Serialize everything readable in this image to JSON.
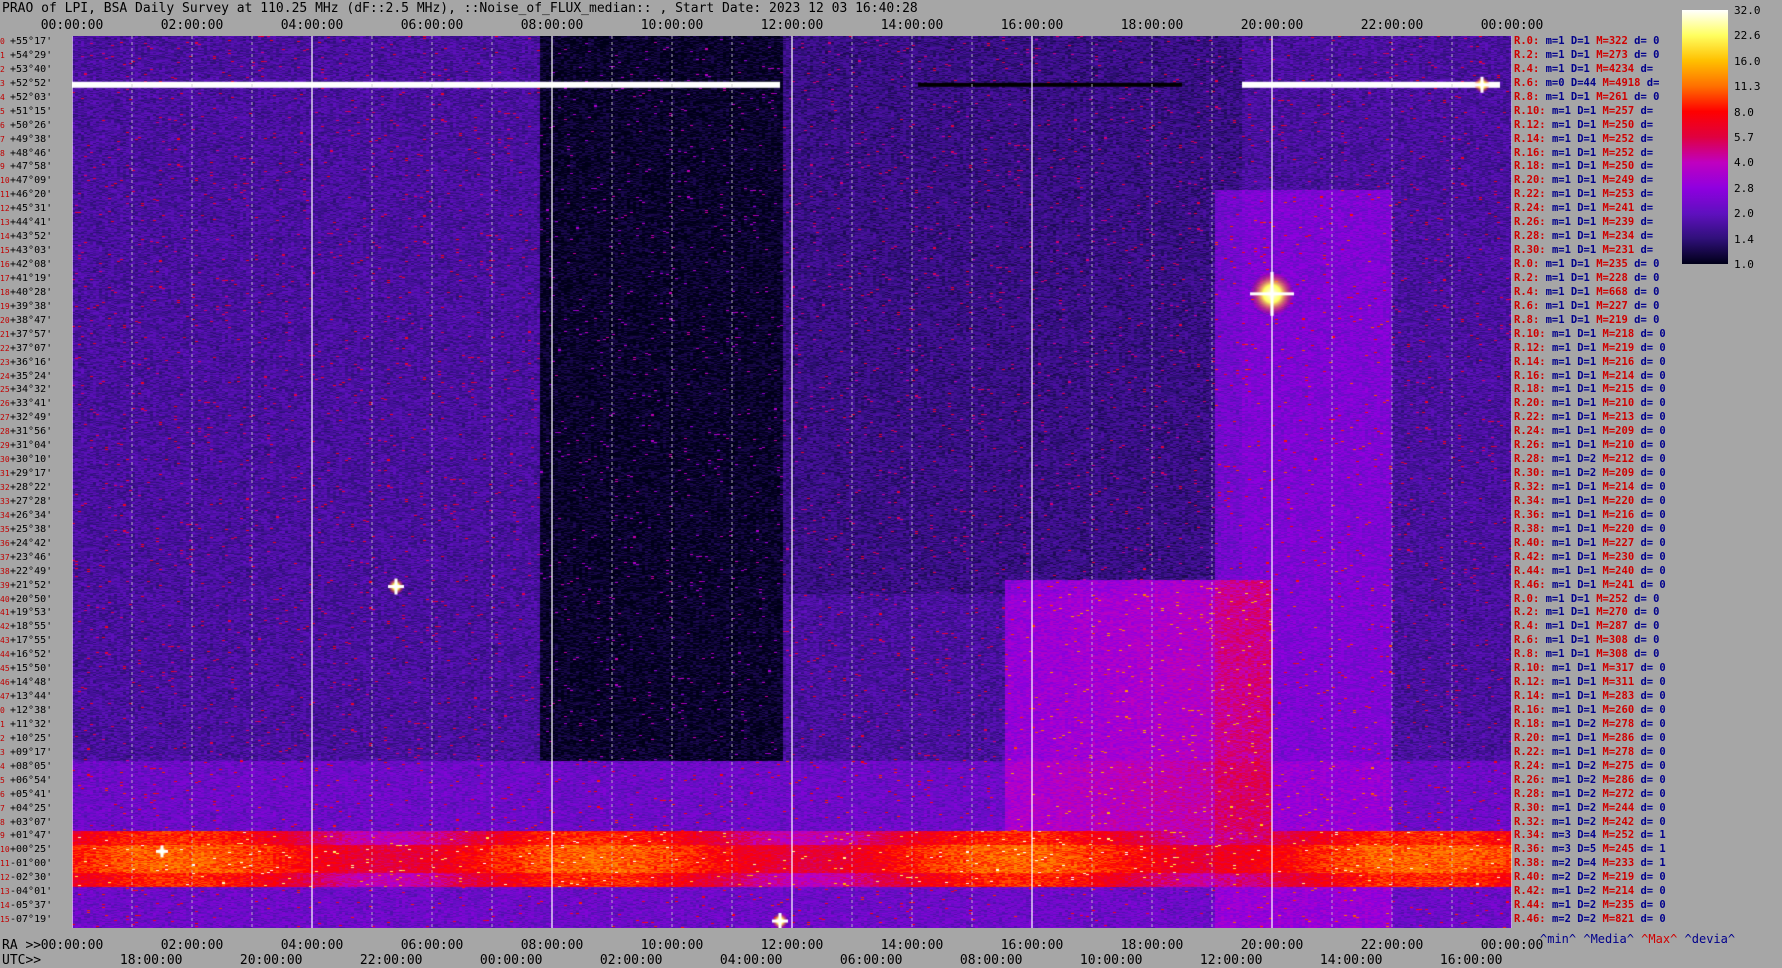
{
  "title": "PRAO of LPI, BSA Daily Survey at 110.25 MHz (dF::2.5 MHz), ::Noise_of_FLUX_median:: , Start Date: 2023 12 03 16:40:28",
  "axes": {
    "ra_prefix": "RA >>",
    "utc_prefix": "UTC>>"
  },
  "top_ticks": [
    "00:00:00",
    "02:00:00",
    "04:00:00",
    "06:00:00",
    "08:00:00",
    "10:00:00",
    "12:00:00",
    "14:00:00",
    "16:00:00",
    "18:00:00",
    "20:00:00",
    "22:00:00",
    "00:00:00"
  ],
  "bottom_ra_ticks": [
    "00:00:00",
    "02:00:00",
    "04:00:00",
    "06:00:00",
    "08:00:00",
    "10:00:00",
    "12:00:00",
    "14:00:00",
    "16:00:00",
    "18:00:00",
    "20:00:00",
    "22:00:00",
    "00:00:00"
  ],
  "bottom_utc_ticks": [
    "18:00:00",
    "20:00:00",
    "22:00:00",
    "00:00:00",
    "02:00:00",
    "04:00:00",
    "06:00:00",
    "08:00:00",
    "10:00:00",
    "12:00:00",
    "14:00:00",
    "16:00:00"
  ],
  "declinations": [
    "+55°17'",
    "+54°29'",
    "+53°40'",
    "+52°52'",
    "+52°03'",
    "+51°15'",
    "+50°26'",
    "+49°38'",
    "+48°46'",
    "+47°58'",
    "+47°09'",
    "+46°20'",
    "+45°31'",
    "+44°41'",
    "+43°52'",
    "+43°03'",
    "+42°08'",
    "+41°19'",
    "+40°28'",
    "+39°38'",
    "+38°47'",
    "+37°57'",
    "+37°07'",
    "+36°16'",
    "+35°24'",
    "+34°32'",
    "+33°41'",
    "+32°49'",
    "+31°56'",
    "+31°04'",
    "+30°10'",
    "+29°17'",
    "+28°22'",
    "+27°28'",
    "+26°34'",
    "+25°38'",
    "+24°42'",
    "+23°46'",
    "+22°49'",
    "+21°52'",
    "+20°50'",
    "+19°53'",
    "+18°55'",
    "+17°55'",
    "+16°52'",
    "+15°50'",
    "+14°48'",
    "+13°44'",
    "+12°38'",
    "+11°32'",
    "+10°25'",
    "+09°17'",
    "+08°05'",
    "+06°54'",
    "+05°41'",
    "+04°25'",
    "+03°07'",
    "+01°47'",
    "+00°25'",
    "-01°00'",
    "-02°30'",
    "-04°01'",
    "-05°37'",
    "-07°19'"
  ],
  "row_stats": [
    {
      "r": "R.0:",
      "m": "m=1",
      "D": "D=1",
      "M": "M=322",
      "d": "d= 0"
    },
    {
      "r": "R.2:",
      "m": "m=1",
      "D": "D=1",
      "M": "M=273",
      "d": "d= 0"
    },
    {
      "r": "R.4:",
      "m": "m=1",
      "D": "D=1",
      "M": "M=4234",
      "d": "d="
    },
    {
      "r": "R.6:",
      "m": "m=0",
      "D": "D=44",
      "M": "M=4918",
      "d": "d="
    },
    {
      "r": "R.8:",
      "m": "m=1",
      "D": "D=1",
      "M": "M=261",
      "d": "d= 0"
    },
    {
      "r": "R.10:",
      "m": "m=1",
      "D": "D=1",
      "M": "M=257",
      "d": "d="
    },
    {
      "r": "R.12:",
      "m": "m=1",
      "D": "D=1",
      "M": "M=250",
      "d": "d="
    },
    {
      "r": "R.14:",
      "m": "m=1",
      "D": "D=1",
      "M": "M=252",
      "d": "d="
    },
    {
      "r": "R.16:",
      "m": "m=1",
      "D": "D=1",
      "M": "M=252",
      "d": "d="
    },
    {
      "r": "R.18:",
      "m": "m=1",
      "D": "D=1",
      "M": "M=250",
      "d": "d="
    },
    {
      "r": "R.20:",
      "m": "m=1",
      "D": "D=1",
      "M": "M=249",
      "d": "d="
    },
    {
      "r": "R.22:",
      "m": "m=1",
      "D": "D=1",
      "M": "M=253",
      "d": "d="
    },
    {
      "r": "R.24:",
      "m": "m=1",
      "D": "D=1",
      "M": "M=241",
      "d": "d="
    },
    {
      "r": "R.26:",
      "m": "m=1",
      "D": "D=1",
      "M": "M=239",
      "d": "d="
    },
    {
      "r": "R.28:",
      "m": "m=1",
      "D": "D=1",
      "M": "M=234",
      "d": "d="
    },
    {
      "r": "R.30:",
      "m": "m=1",
      "D": "D=1",
      "M": "M=231",
      "d": "d="
    },
    {
      "r": "R.0:",
      "m": "m=1",
      "D": "D=1",
      "M": "M=235",
      "d": "d= 0"
    },
    {
      "r": "R.2:",
      "m": "m=1",
      "D": "D=1",
      "M": "M=228",
      "d": "d= 0"
    },
    {
      "r": "R.4:",
      "m": "m=1",
      "D": "D=1",
      "M": "M=668",
      "d": "d= 0"
    },
    {
      "r": "R.6:",
      "m": "m=1",
      "D": "D=1",
      "M": "M=227",
      "d": "d= 0"
    },
    {
      "r": "R.8:",
      "m": "m=1",
      "D": "D=1",
      "M": "M=219",
      "d": "d= 0"
    },
    {
      "r": "R.10:",
      "m": "m=1",
      "D": "D=1",
      "M": "M=218",
      "d": "d= 0"
    },
    {
      "r": "R.12:",
      "m": "m=1",
      "D": "D=1",
      "M": "M=219",
      "d": "d= 0"
    },
    {
      "r": "R.14:",
      "m": "m=1",
      "D": "D=1",
      "M": "M=216",
      "d": "d= 0"
    },
    {
      "r": "R.16:",
      "m": "m=1",
      "D": "D=1",
      "M": "M=214",
      "d": "d= 0"
    },
    {
      "r": "R.18:",
      "m": "m=1",
      "D": "D=1",
      "M": "M=215",
      "d": "d= 0"
    },
    {
      "r": "R.20:",
      "m": "m=1",
      "D": "D=1",
      "M": "M=210",
      "d": "d= 0"
    },
    {
      "r": "R.22:",
      "m": "m=1",
      "D": "D=1",
      "M": "M=213",
      "d": "d= 0"
    },
    {
      "r": "R.24:",
      "m": "m=1",
      "D": "D=1",
      "M": "M=209",
      "d": "d= 0"
    },
    {
      "r": "R.26:",
      "m": "m=1",
      "D": "D=1",
      "M": "M=210",
      "d": "d= 0"
    },
    {
      "r": "R.28:",
      "m": "m=1",
      "D": "D=2",
      "M": "M=212",
      "d": "d= 0"
    },
    {
      "r": "R.30:",
      "m": "m=1",
      "D": "D=2",
      "M": "M=209",
      "d": "d= 0"
    },
    {
      "r": "R.32:",
      "m": "m=1",
      "D": "D=1",
      "M": "M=214",
      "d": "d= 0"
    },
    {
      "r": "R.34:",
      "m": "m=1",
      "D": "D=1",
      "M": "M=220",
      "d": "d= 0"
    },
    {
      "r": "R.36:",
      "m": "m=1",
      "D": "D=1",
      "M": "M=216",
      "d": "d= 0"
    },
    {
      "r": "R.38:",
      "m": "m=1",
      "D": "D=1",
      "M": "M=220",
      "d": "d= 0"
    },
    {
      "r": "R.40:",
      "m": "m=1",
      "D": "D=1",
      "M": "M=227",
      "d": "d= 0"
    },
    {
      "r": "R.42:",
      "m": "m=1",
      "D": "D=1",
      "M": "M=230",
      "d": "d= 0"
    },
    {
      "r": "R.44:",
      "m": "m=1",
      "D": "D=1",
      "M": "M=240",
      "d": "d= 0"
    },
    {
      "r": "R.46:",
      "m": "m=1",
      "D": "D=1",
      "M": "M=241",
      "d": "d= 0"
    },
    {
      "r": "R.0:",
      "m": "m=1",
      "D": "D=1",
      "M": "M=252",
      "d": "d= 0"
    },
    {
      "r": "R.2:",
      "m": "m=1",
      "D": "D=1",
      "M": "M=270",
      "d": "d= 0"
    },
    {
      "r": "R.4:",
      "m": "m=1",
      "D": "D=1",
      "M": "M=287",
      "d": "d= 0"
    },
    {
      "r": "R.6:",
      "m": "m=1",
      "D": "D=1",
      "M": "M=308",
      "d": "d= 0"
    },
    {
      "r": "R.8:",
      "m": "m=1",
      "D": "D=1",
      "M": "M=308",
      "d": "d= 0"
    },
    {
      "r": "R.10:",
      "m": "m=1",
      "D": "D=1",
      "M": "M=317",
      "d": "d= 0"
    },
    {
      "r": "R.12:",
      "m": "m=1",
      "D": "D=1",
      "M": "M=311",
      "d": "d= 0"
    },
    {
      "r": "R.14:",
      "m": "m=1",
      "D": "D=1",
      "M": "M=283",
      "d": "d= 0"
    },
    {
      "r": "R.16:",
      "m": "m=1",
      "D": "D=1",
      "M": "M=260",
      "d": "d= 0"
    },
    {
      "r": "R.18:",
      "m": "m=1",
      "D": "D=2",
      "M": "M=278",
      "d": "d= 0"
    },
    {
      "r": "R.20:",
      "m": "m=1",
      "D": "D=1",
      "M": "M=286",
      "d": "d= 0"
    },
    {
      "r": "R.22:",
      "m": "m=1",
      "D": "D=1",
      "M": "M=278",
      "d": "d= 0"
    },
    {
      "r": "R.24:",
      "m": "m=1",
      "D": "D=2",
      "M": "M=275",
      "d": "d= 0"
    },
    {
      "r": "R.26:",
      "m": "m=1",
      "D": "D=2",
      "M": "M=286",
      "d": "d= 0"
    },
    {
      "r": "R.28:",
      "m": "m=1",
      "D": "D=2",
      "M": "M=272",
      "d": "d= 0"
    },
    {
      "r": "R.30:",
      "m": "m=1",
      "D": "D=2",
      "M": "M=244",
      "d": "d= 0"
    },
    {
      "r": "R.32:",
      "m": "m=1",
      "D": "D=2",
      "M": "M=242",
      "d": "d= 0"
    },
    {
      "r": "R.34:",
      "m": "m=3",
      "D": "D=4",
      "M": "M=252",
      "d": "d= 1"
    },
    {
      "r": "R.36:",
      "m": "m=3",
      "D": "D=5",
      "M": "M=245",
      "d": "d= 1"
    },
    {
      "r": "R.38:",
      "m": "m=2",
      "D": "D=4",
      "M": "M=233",
      "d": "d= 1"
    },
    {
      "r": "R.40:",
      "m": "m=2",
      "D": "D=2",
      "M": "M=219",
      "d": "d= 0"
    },
    {
      "r": "R.42:",
      "m": "m=1",
      "D": "D=2",
      "M": "M=214",
      "d": "d= 0"
    },
    {
      "r": "R.44:",
      "m": "m=1",
      "D": "D=2",
      "M": "M=235",
      "d": "d= 0"
    },
    {
      "r": "R.46:",
      "m": "m=2",
      "D": "D=2",
      "M": "M=821",
      "d": "d= 0"
    }
  ],
  "legend": {
    "min": "^min^",
    "median": "^Media^",
    "max": "^Max^",
    "devia": "^devia^"
  },
  "colorbar": {
    "ticks": [
      "32.0",
      "22.6",
      "16.0",
      "11.3",
      "8.0",
      "5.7",
      "4.0",
      "2.8",
      "2.0",
      "1.4",
      "1.0"
    ],
    "stops": [
      "#ffffff",
      "#ffff60",
      "#ffc000",
      "#ff7000",
      "#ff0000",
      "#e00040",
      "#c000c0",
      "#9000e0",
      "#6010c0",
      "#30107a",
      "#000018"
    ]
  },
  "chart_data": {
    "type": "heatmap",
    "title": "PRAO of LPI, BSA Daily Survey at 110.25 MHz (dF::2.5 MHz), ::Noise_of_FLUX_median:: , Start Date: 2023 12 03 16:40:28",
    "x_axis": "RA 00:00:00 to 24:00:00 (top/bottom), UTC 16:40 to 16:40 (bottom)",
    "y_axis": "Declination +55°17' to -07°19'",
    "rows": 64,
    "value_range": [
      1.0,
      32.0
    ],
    "scale": "log2",
    "features": [
      {
        "label": "horizontal saturated band",
        "dec": "+52°52'",
        "ra_range": [
          "00:00",
          "11:50"
        ],
        "value": 32.0
      },
      {
        "label": "horizontal saturated band",
        "dec": "+52°52'",
        "ra_range": [
          "19:30",
          "23:50"
        ],
        "value": 32.0
      },
      {
        "label": "bright source",
        "dec": "+40°28'",
        "ra": "20:00",
        "value": 32.0
      },
      {
        "label": "galactic plane emission",
        "dec_range": [
          "+01°47'",
          "-02°30'"
        ],
        "value": 8.0
      },
      {
        "label": "bright source",
        "dec": "+21°52'",
        "ra": "05:40",
        "value": 16.0
      },
      {
        "label": "bright source",
        "dec": "-07°19'",
        "ra": "11:50",
        "value": 32.0
      }
    ]
  }
}
